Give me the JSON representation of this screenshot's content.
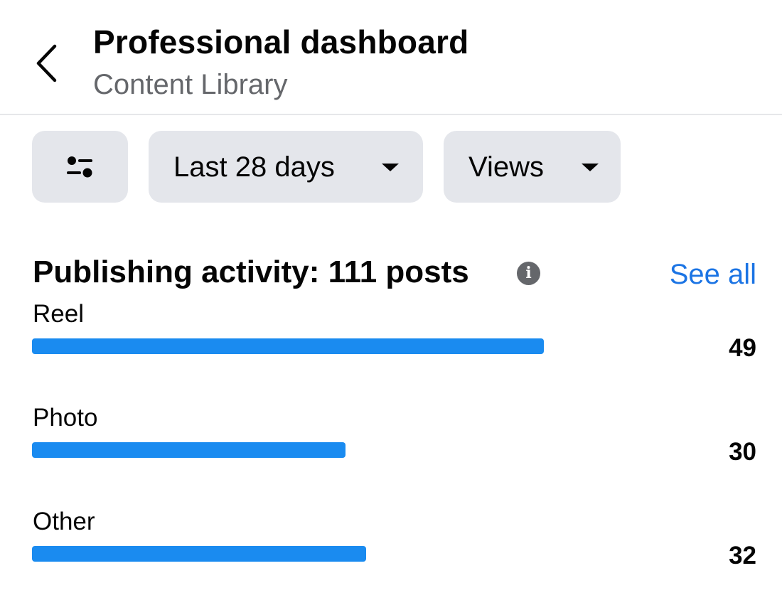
{
  "header": {
    "title": "Professional dashboard",
    "subtitle": "Content Library"
  },
  "filters": {
    "filter_icon": "sliders-icon",
    "date_range": "Last 28 days",
    "metric": "Views"
  },
  "publishing": {
    "title": "Publishing activity: 111 posts",
    "info_icon": "i",
    "see_all": "See all",
    "accent_color": "#1a8bf0",
    "max_value": 49,
    "rows": [
      {
        "label": "Reel",
        "value": "49",
        "count": 49
      },
      {
        "label": "Photo",
        "value": "30",
        "count": 30
      },
      {
        "label": "Other",
        "value": "32",
        "count": 32
      }
    ]
  }
}
